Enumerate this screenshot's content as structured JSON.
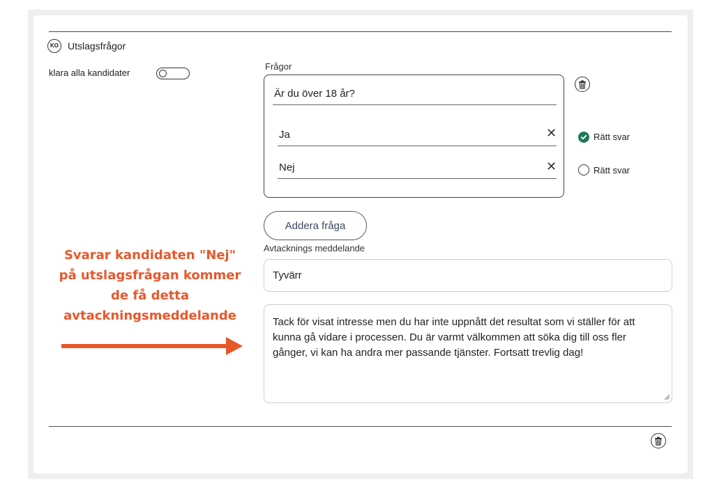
{
  "section": {
    "badge": "KO",
    "title": "Utslagsfrågor"
  },
  "toggle": {
    "label": "klara alla kandidater",
    "state": "off"
  },
  "questions": {
    "label": "Frågor",
    "question_text": "Är du över 18 år?",
    "answers": [
      {
        "text": "Ja",
        "correct_label": "Rätt svar",
        "is_correct": true
      },
      {
        "text": "Nej",
        "correct_label": "Rätt svar",
        "is_correct": false
      }
    ],
    "add_button": "Addera fråga"
  },
  "rejection": {
    "label": "Avtacknings meddelande",
    "subject": "Tyvärr",
    "body": "Tack för visat intresse men du har inte uppnått det resultat som vi ställer för att kunna gå vidare i processen. Du är varmt välkommen att söka dig till oss fler gånger, vi kan ha andra mer passande tjänster. Fortsatt trevlig dag!"
  },
  "annotation": {
    "lines": [
      "Svarar kandidaten \"Nej\"",
      "på utslagsfrågan kommer",
      "de få detta",
      "avtackningsmeddelande"
    ],
    "color": "#e8572a"
  },
  "icons": {
    "trash": "trash-icon",
    "check": "check-circle-icon",
    "clear": "close-icon"
  },
  "colors": {
    "correct_green": "#1f7a55",
    "button_text": "#3b4a60"
  }
}
